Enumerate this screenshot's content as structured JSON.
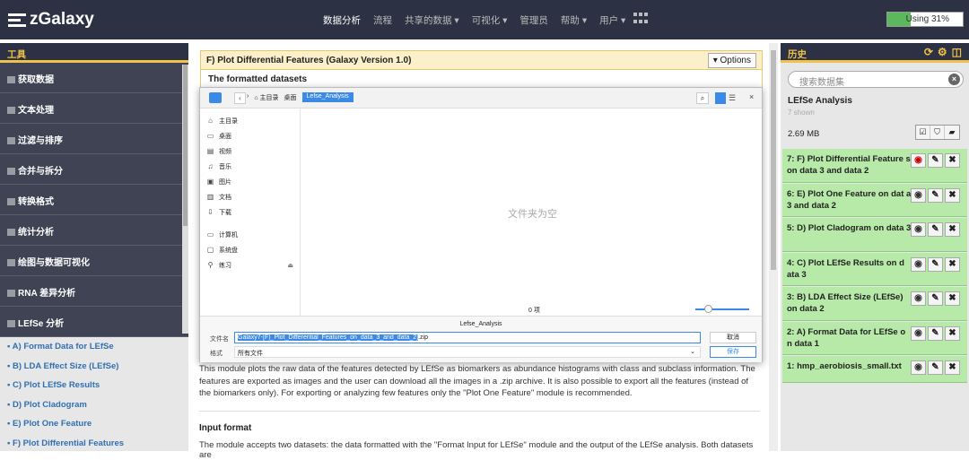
{
  "header": {
    "brand": "zGalaxy",
    "nav": [
      "数据分析",
      "流程",
      "共享的数据 ▾",
      "可视化 ▾",
      "管理员",
      "帮助 ▾",
      "用户 ▾"
    ],
    "usage": "Using 31%",
    "usage_fraction": 0.31
  },
  "tools": {
    "title": "工具",
    "sections": [
      "获取数据",
      "文本处理",
      "过滤与排序",
      "合并与拆分",
      "转换格式",
      "统计分析",
      "绘图与数据可视化",
      "RNA 差异分析",
      "LEfSe 分析"
    ],
    "items": [
      "A) Format Data for LEfSe",
      "B) LDA Effect Size (LEfSe)",
      "C) Plot LEfSe Results",
      "D) Plot Cladogram",
      "E) Plot One Feature",
      "F) Plot Differential Features"
    ]
  },
  "center": {
    "title": "F) Plot Differential Features (Galaxy Version 1.0)",
    "options_label": "▾ Options",
    "subtitle": "The formatted datasets",
    "description": "This module plots the raw data of the features detected by LEfSe as biomarkers as abundance histograms with class and subclass information. The features are exported as images and the user can download all the images in a .zip archive. It is also possible to export all the features (instead of the biomarkers only). For exporting or analyzing few features only the \"Plot One Feature\" module is recommended.",
    "input_heading": "Input format",
    "input_text": "The module accepts two datasets: the data formatted with the \"Format Input for LEfSe\" module and the output of the LEfSe analysis. Both datasets are"
  },
  "dialog": {
    "crumbs": [
      "⌂ 主目录",
      "桌面",
      "Lefse_Analysis"
    ],
    "places": [
      {
        "icon": "⌂",
        "label": "主目录"
      },
      {
        "icon": "▭",
        "label": "桌面"
      },
      {
        "icon": "▤",
        "label": "视频"
      },
      {
        "icon": "♫",
        "label": "音乐"
      },
      {
        "icon": "▣",
        "label": "图片"
      },
      {
        "icon": "▥",
        "label": "文档"
      },
      {
        "icon": "⇩",
        "label": "下载"
      }
    ],
    "devices": [
      {
        "icon": "▭",
        "label": "计算机"
      },
      {
        "icon": "▢",
        "label": "系统盘"
      },
      {
        "icon": "⚲",
        "label": "练习"
      }
    ],
    "eject": "⏏",
    "empty_text": "文件夹为空",
    "item_count": "0 项",
    "folder_name": "Lefse_Analysis",
    "filename_label": "文件名",
    "filename_selected": "Galaxy7-[F)_Plot_Differential_Features_on_data_3_and_data_2]",
    "filename_ext": ".zip",
    "format_label": "格式",
    "format_value": "所有文件",
    "cancel": "取消",
    "save": "保存",
    "close": "×",
    "back": "‹",
    "forward": "›"
  },
  "history": {
    "title": "历史",
    "search_placeholder": "搜索数据集",
    "name": "LEfSe Analysis",
    "shown": "7 shown",
    "size": "2.69 MB",
    "datasets": [
      {
        "label": "7: F) Plot Differential Feature s on data 3 and data 2",
        "viewing": true
      },
      {
        "label": "6: E) Plot One Feature on dat a 3 and data 2",
        "viewing": false
      },
      {
        "label": "5: D) Plot Cladogram on data 3",
        "viewing": false
      },
      {
        "label": "4: C) Plot LEfSe Results on d ata 3",
        "viewing": false
      },
      {
        "label": "3: B) LDA Effect Size (LEfSe) on data 2",
        "viewing": false
      },
      {
        "label": "2: A) Format Data for LEfSe o n data 1",
        "viewing": false
      },
      {
        "label": "1: hmp_aerobiosis_small.txt",
        "viewing": false
      }
    ]
  }
}
